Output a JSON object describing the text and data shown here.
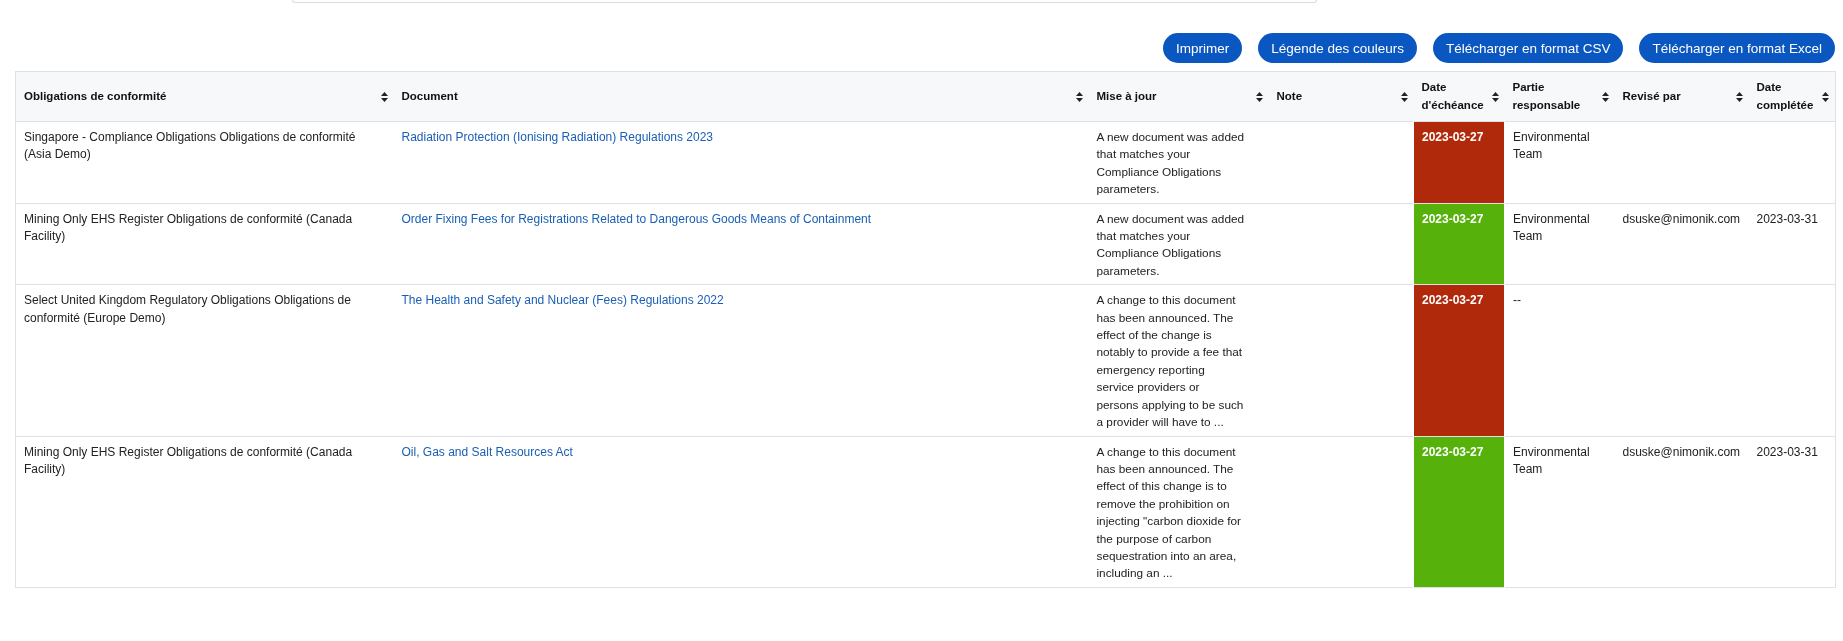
{
  "toolbar": {
    "buttons": [
      "Imprimer",
      "Légende des couleurs",
      "Télécharger en format CSV",
      "Télécharger en format Excel"
    ]
  },
  "table": {
    "columns": [
      {
        "label": "Obligations de conformité"
      },
      {
        "label": "Document"
      },
      {
        "label": "Mise à jour"
      },
      {
        "label": "Note"
      },
      {
        "label": "Date d'échéance"
      },
      {
        "label": "Partie responsable"
      },
      {
        "label": "Revisé par"
      },
      {
        "label": "Date complétée"
      }
    ],
    "rows": [
      {
        "obligation": "Singapore - Compliance Obligations Obligations de conformité (Asia Demo)",
        "document": "Radiation Protection (Ionising Radiation) Regulations 2023",
        "update": "A new document was added that matches your Compliance Obligations parameters.",
        "due_date": "2023-03-27",
        "color": "#b0290b",
        "responsible": "Environmental Team"
      },
      {
        "obligation": "Mining Only EHS Register Obligations de conformité (Canada Facility)",
        "document": "Order Fixing Fees for Registrations Related to Dangerous Goods Means of Containment",
        "update": "A new document was added that matches your Compliance Obligations parameters.",
        "due_date": "2023-03-27",
        "color": "#56b20a",
        "responsible": "Environmental Team",
        "reviewed_by": "dsuske@nimonik.com",
        "completed": "2023-03-31"
      },
      {
        "obligation": "Select United Kingdom Regulatory Obligations Obligations de conformité (Europe Demo)",
        "document": "The Health and Safety and Nuclear (Fees) Regulations 2022",
        "update": "A change to this document has been announced. The effect of the change is notably to provide a fee that emergency reporting service providers or persons applying to be such a provider will have to ...",
        "due_date": "2023-03-27",
        "color": "#b0290b",
        "responsible": "--"
      },
      {
        "obligation": "Mining Only EHS Register Obligations de conformité (Canada Facility)",
        "document": "Oil, Gas and Salt Resources Act",
        "update": "A change to this document has been announced. The effect of this change is to remove the prohibition on injecting \"carbon dioxide for the purpose of carbon sequestration into an area, including an ...",
        "due_date": "2023-03-27",
        "color": "#56b20a",
        "responsible": "Environmental Team",
        "reviewed_by": "dsuske@nimonik.com",
        "completed": "2023-03-31"
      }
    ]
  }
}
